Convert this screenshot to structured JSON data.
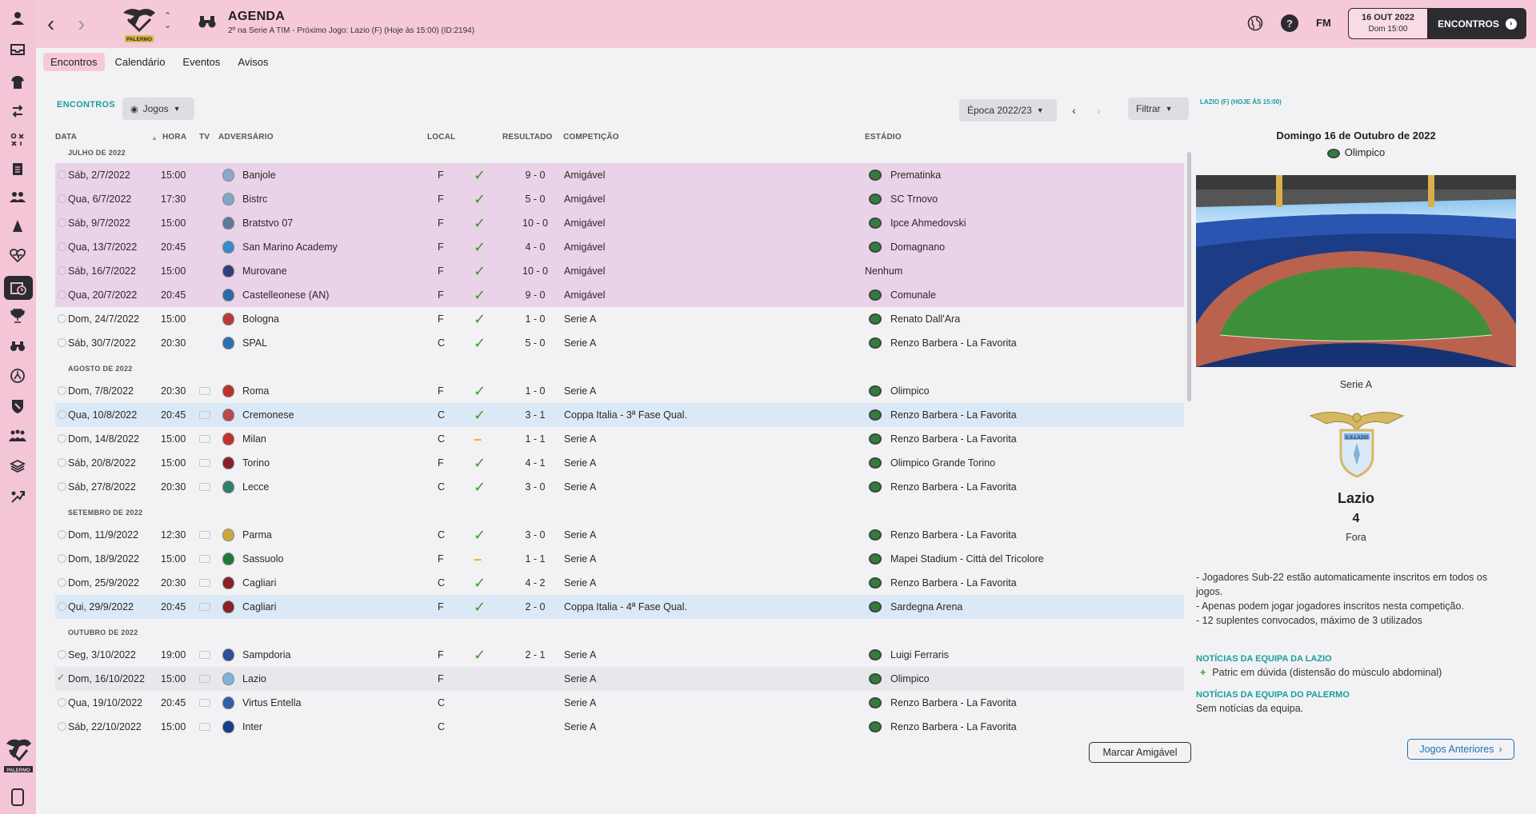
{
  "sidebar": {
    "icons": [
      "person-icon",
      "inbox-icon",
      "squad-icon",
      "transfers-icon",
      "tactics-icon",
      "clipboard-icon",
      "staff-icon",
      "training-icon",
      "medical-icon",
      "schedule-icon",
      "trophy-icon",
      "scouting-icon",
      "youth-icon",
      "club-icon",
      "people-icon",
      "finances-icon",
      "development-icon"
    ],
    "active_index": 9,
    "logo_name": "palermo-logo"
  },
  "header": {
    "title": "AGENDA",
    "subtitle": "2º na Serie A TIM - Próximo Jogo: Lazio (F) (Hoje às 15:00) (ID:2194)",
    "club_name": "PALERMO",
    "fm_label": "FM",
    "help_label": "?",
    "date_main": "16 OUT 2022",
    "date_sub": "Dom 15:00",
    "continue_label": "ENCONTROS"
  },
  "tabs": [
    "Encontros",
    "Calendário",
    "Eventos",
    "Avisos"
  ],
  "main": {
    "section_title": "ENCONTROS",
    "filter_games": "Jogos",
    "season": "Época 2022/23",
    "filter_label": "Filtrar",
    "columns": {
      "date": "DATA",
      "time": "HORA",
      "tv": "TV",
      "opponent": "ADVERSÁRIO",
      "venue": "LOCAL",
      "result": "RESULTADO",
      "competition": "COMPETIÇÃO",
      "stadium": "ESTÁDIO"
    },
    "months": [
      "JULHO DE 2022",
      "AGOSTO DE 2022",
      "SETEMBRO DE 2022",
      "OUTUBRO DE 2022"
    ],
    "matches": [
      {
        "date": "Sáb, 2/7/2022",
        "time": "15:00",
        "opponent": "Banjole",
        "venue": "F",
        "outcome": "win",
        "score": "9 - 0",
        "competition": "Amigável",
        "stadium": "Prematinka",
        "row": "pink"
      },
      {
        "date": "Qua, 6/7/2022",
        "time": "17:30",
        "opponent": "Bistrc",
        "venue": "F",
        "outcome": "win",
        "score": "5 - 0",
        "competition": "Amigável",
        "stadium": "SC Trnovo",
        "row": "pink"
      },
      {
        "date": "Sáb, 9/7/2022",
        "time": "15:00",
        "opponent": "Bratstvo 07",
        "venue": "F",
        "outcome": "win",
        "score": "10 - 0",
        "competition": "Amigável",
        "stadium": "Ipce Ahmedovski",
        "row": "pink"
      },
      {
        "date": "Qua, 13/7/2022",
        "time": "20:45",
        "opponent": "San Marino Academy",
        "venue": "F",
        "outcome": "win",
        "score": "4 - 0",
        "competition": "Amigável",
        "stadium": "Domagnano",
        "row": "pink"
      },
      {
        "date": "Sáb, 16/7/2022",
        "time": "15:00",
        "opponent": "Murovane",
        "venue": "F",
        "outcome": "win",
        "score": "10 - 0",
        "competition": "Amigável",
        "stadium": "Nenhum",
        "row": "pink"
      },
      {
        "date": "Qua, 20/7/2022",
        "time": "20:45",
        "opponent": "Castelleonese (AN)",
        "venue": "F",
        "outcome": "win",
        "score": "9 - 0",
        "competition": "Amigável",
        "stadium": "Comunale",
        "row": "pink"
      },
      {
        "date": "Dom, 24/7/2022",
        "time": "15:00",
        "opponent": "Bologna",
        "venue": "F",
        "outcome": "win",
        "score": "1 - 0",
        "competition": "Serie A",
        "stadium": "Renato Dall'Ara",
        "row": "white"
      },
      {
        "date": "Sáb, 30/7/2022",
        "time": "20:30",
        "opponent": "SPAL",
        "venue": "C",
        "outcome": "win",
        "score": "5 - 0",
        "competition": "Serie A",
        "stadium": "Renzo Barbera - La Favorita",
        "row": "white"
      },
      {
        "date": "Dom, 7/8/2022",
        "time": "20:30",
        "opponent": "Roma",
        "venue": "F",
        "outcome": "win",
        "score": "1 - 0",
        "competition": "Serie A",
        "stadium": "Olimpico",
        "row": "white"
      },
      {
        "date": "Qua, 10/8/2022",
        "time": "20:45",
        "opponent": "Cremonese",
        "venue": "C",
        "outcome": "win",
        "score": "3 - 1",
        "competition": "Coppa Italia - 3ª Fase Qual.",
        "stadium": "Renzo Barbera - La Favorita",
        "row": "blue"
      },
      {
        "date": "Dom, 14/8/2022",
        "time": "15:00",
        "opponent": "Milan",
        "venue": "C",
        "outcome": "draw",
        "score": "1 - 1",
        "competition": "Serie A",
        "stadium": "Renzo Barbera - La Favorita",
        "row": "white"
      },
      {
        "date": "Sáb, 20/8/2022",
        "time": "15:00",
        "opponent": "Torino",
        "venue": "F",
        "outcome": "win",
        "score": "4 - 1",
        "competition": "Serie A",
        "stadium": "Olimpico Grande Torino",
        "row": "white"
      },
      {
        "date": "Sáb, 27/8/2022",
        "time": "20:30",
        "opponent": "Lecce",
        "venue": "C",
        "outcome": "win",
        "score": "3 - 0",
        "competition": "Serie A",
        "stadium": "Renzo Barbera - La Favorita",
        "row": "white"
      },
      {
        "date": "Dom, 11/9/2022",
        "time": "12:30",
        "opponent": "Parma",
        "venue": "C",
        "outcome": "win",
        "score": "3 - 0",
        "competition": "Serie A",
        "stadium": "Renzo Barbera - La Favorita",
        "row": "white"
      },
      {
        "date": "Dom, 18/9/2022",
        "time": "15:00",
        "opponent": "Sassuolo",
        "venue": "F",
        "outcome": "draw",
        "score": "1 - 1",
        "competition": "Serie A",
        "stadium": "Mapei Stadium - Città del Tricolore",
        "row": "white"
      },
      {
        "date": "Dom, 25/9/2022",
        "time": "20:30",
        "opponent": "Cagliari",
        "venue": "C",
        "outcome": "win",
        "score": "4 - 2",
        "competition": "Serie A",
        "stadium": "Renzo Barbera - La Favorita",
        "row": "white"
      },
      {
        "date": "Qui, 29/9/2022",
        "time": "20:45",
        "opponent": "Cagliari",
        "venue": "F",
        "outcome": "win",
        "score": "2 - 0",
        "competition": "Coppa Italia - 4ª Fase Qual.",
        "stadium": "Sardegna Arena",
        "row": "blue"
      },
      {
        "date": "Seg, 3/10/2022",
        "time": "19:00",
        "opponent": "Sampdoria",
        "venue": "F",
        "outcome": "win",
        "score": "2 - 1",
        "competition": "Serie A",
        "stadium": "Luigi Ferraris",
        "row": "white"
      },
      {
        "date": "Dom, 16/10/2022",
        "time": "15:00",
        "opponent": "Lazio",
        "venue": "F",
        "outcome": "none",
        "score": "",
        "competition": "Serie A",
        "stadium": "Olimpico",
        "row": "cur"
      },
      {
        "date": "Qua, 19/10/2022",
        "time": "20:45",
        "opponent": "Virtus Entella",
        "venue": "C",
        "outcome": "none",
        "score": "",
        "competition": "Serie A",
        "stadium": "Renzo Barbera - La Favorita",
        "row": "white"
      },
      {
        "date": "Sáb, 22/10/2022",
        "time": "15:00",
        "opponent": "Inter",
        "venue": "C",
        "outcome": "none",
        "score": "",
        "competition": "Serie A",
        "stadium": "Renzo Barbera - La Favorita",
        "row": "white"
      }
    ],
    "arrange_friendly": "Marcar Amigável"
  },
  "panel": {
    "next_label": "LAZIO (F) (HOJE ÀS 15:00)",
    "date": "Domingo 16 de Outubro de 2022",
    "venue": "Olimpico",
    "competition": "Serie A",
    "team": "Lazio",
    "position": "4",
    "venue_type": "Fora",
    "crest_text": "S.S.LAZIO",
    "rules": [
      "- Jogadores Sub-22 estão automaticamente inscritos em todos os jogos.",
      "- Apenas podem jogar jogadores inscritos nesta competição.",
      "- 12 suplentes convocados, máximo de 3 utilizados"
    ],
    "news_lazio_title": "NOTÍCIAS DA EQUIPA DA LAZIO",
    "news_lazio_item": "Patric em dúvida (distensão do músculo abdominal)",
    "news_palermo_title": "NOTÍCIAS DA EQUIPA DO PALERMO",
    "news_palermo_item": "Sem notícias da equipa.",
    "previous_games": "Jogos Anteriores"
  },
  "colors": {
    "sidebar": "#f4c5d6",
    "header": "#f6c9d9",
    "accent": "#1a9e9e",
    "friendly_row": "#ead2e9",
    "cup_row": "#dbe9f6",
    "win": "#3a9b2a",
    "draw": "#e8b400"
  }
}
